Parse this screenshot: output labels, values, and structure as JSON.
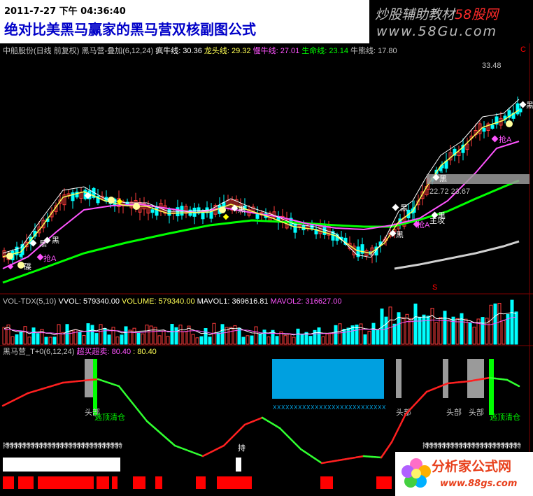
{
  "header": {
    "datetime": "2011-7-27 下午 04:36:40",
    "title": "绝对比美黑马赢家的黑马营双核副图公式",
    "logo_text_a": "炒股辅助教材",
    "logo_text_b": "58股网",
    "logo_url": "www.58Gu.com"
  },
  "main_panel": {
    "legend": [
      {
        "text": "中船股份(日线 前复权) 黑马营-叠加(6,12,24)",
        "color": "#c0c0c0"
      },
      {
        "text": "疯牛线: 30.36",
        "color": "#ffffff"
      },
      {
        "text": "龙头线: 29.32",
        "color": "#ffff54"
      },
      {
        "text": "慢牛线: 27.01",
        "color": "#ff54ff"
      },
      {
        "text": "生命线: 23.14",
        "color": "#00ff00"
      },
      {
        "text": "牛熊线: 17.80",
        "color": "#c0c0c0"
      }
    ],
    "price_high_label": "33.48",
    "price_box_label": "22.72 23.67",
    "markers": [
      {
        "text": "黑",
        "color": "#ffffff"
      },
      {
        "text": "抢A",
        "color": "#ff54ff"
      },
      {
        "text": "主攻",
        "color": "#ffffff"
      },
      {
        "text": "碟",
        "color": "#ffffff"
      },
      {
        "text": "C",
        "color": "#ff0000"
      },
      {
        "text": "S",
        "color": "#ff0000"
      }
    ],
    "colors": {
      "up": "#ff3c3c",
      "down": "#00ffff",
      "fast": "#ffffff",
      "leader": "#ffff54",
      "slow": "#ff54ff",
      "life": "#00ff00",
      "bullbear": "#d0d0d0"
    }
  },
  "volume_panel": {
    "legend": [
      {
        "text": "VOL-TDX(5,10)",
        "color": "#c0c0c0"
      },
      {
        "text": "VVOL: 579340.00",
        "color": "#ffffff"
      },
      {
        "text": "VOLUME: 579340.00",
        "color": "#ffff54"
      },
      {
        "text": "MAVOL1: 369616.81",
        "color": "#ffffff"
      },
      {
        "text": "MAVOL2: 316627.00",
        "color": "#ff54ff"
      }
    ]
  },
  "sub_panel": {
    "legend": [
      {
        "text": "黑马营_T+0(6,12,24)",
        "color": "#c0c0c0"
      },
      {
        "text": "超买超卖: 80.40",
        "color": "#ff54ff"
      },
      {
        "text": ": 80.40",
        "color": "#ffff54"
      }
    ],
    "signals": [
      {
        "text": "头部",
        "color": "#c0c0c0"
      },
      {
        "text": "逃顶清仓",
        "color": "#00ff00"
      },
      {
        "text": "持",
        "color": "#ffffff"
      }
    ]
  },
  "watermark": {
    "name": "分析家公式网",
    "url": "www.88gs.com"
  }
}
